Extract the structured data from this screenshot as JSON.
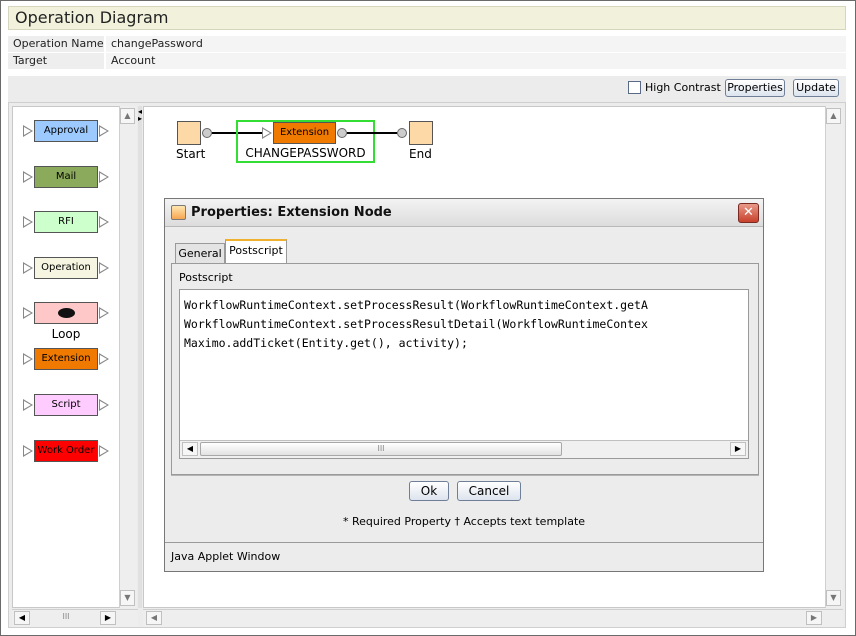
{
  "window": {
    "title": "Operation Diagram"
  },
  "operation": {
    "name_label": "Operation Name",
    "name_value": "changePassword",
    "target_label": "Target",
    "target_value": "Account"
  },
  "toolbar": {
    "high_contrast_label": "High Contrast",
    "high_contrast_checked": false,
    "properties_label": "Properties",
    "update_label": "Update"
  },
  "palette": {
    "items": [
      {
        "label": "Approval",
        "color": "#9ccaff"
      },
      {
        "label": "Mail",
        "color": "#8caa5c"
      },
      {
        "label": "RFI",
        "color": "#ccffcc"
      },
      {
        "label": "Operation",
        "color": "#f5f5e1"
      },
      {
        "label": "Loop",
        "color": "#ffc8c8"
      },
      {
        "label": "Extension",
        "color": "#f07a00"
      },
      {
        "label": "Script",
        "color": "#ffccff"
      },
      {
        "label": "Work Order",
        "color": "#ff0000"
      }
    ]
  },
  "diagram": {
    "start_label": "Start",
    "extension_label": "Extension",
    "extension_caption": "CHANGEPASSWORD",
    "end_label": "End",
    "node_color": "#fdd9a8",
    "selected_color": "#33dd33"
  },
  "dialog": {
    "title": "Properties: Extension Node",
    "tabs": [
      {
        "label": "General"
      },
      {
        "label": "Postscript",
        "active": true
      }
    ],
    "section_label": "Postscript",
    "code_lines": [
      "WorkflowRuntimeContext.setProcessResult(WorkflowRuntimeContext.getA",
      "WorkflowRuntimeContext.setProcessResultDetail(WorkflowRuntimeContex",
      "Maximo.addTicket(Entity.get(), activity);"
    ],
    "ok_label": "Ok",
    "cancel_label": "Cancel",
    "legend": "* Required Property  † Accepts text template",
    "status": "Java Applet Window"
  }
}
